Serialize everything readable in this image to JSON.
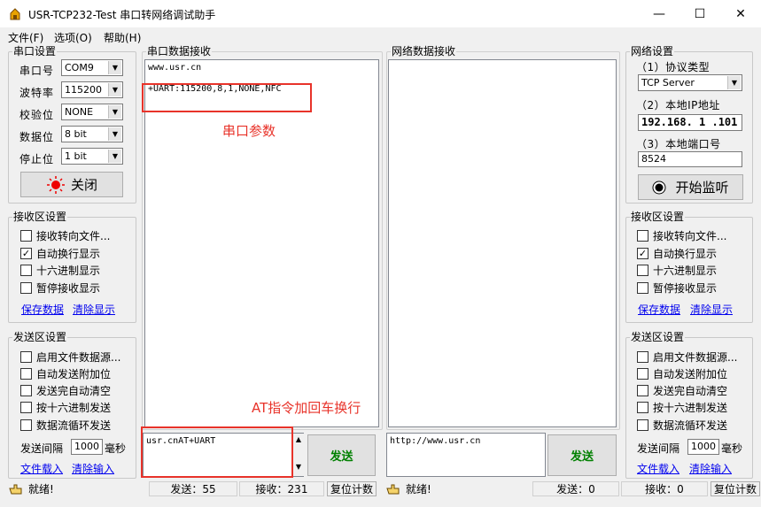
{
  "window": {
    "title": "USR-TCP232-Test 串口转网络调试助手",
    "minimize": "—",
    "maximize": "☐",
    "close": "✕"
  },
  "menu": [
    "文件(F)",
    "选项(O)",
    "帮助(H)"
  ],
  "serial_settings": {
    "title": "串口设置",
    "port_label": "串口号",
    "port_value": "COM9",
    "baud_label": "波特率",
    "baud_value": "115200",
    "parity_label": "校验位",
    "parity_value": "NONE",
    "data_label": "数据位",
    "data_value": "8 bit",
    "stop_label": "停止位",
    "stop_value": "1 bit",
    "close_button": "关闭"
  },
  "left_recv": {
    "title": "接收区设置",
    "options": [
      {
        "label": "接收转向文件...",
        "checked": false
      },
      {
        "label": "自动换行显示",
        "checked": true
      },
      {
        "label": "十六进制显示",
        "checked": false
      },
      {
        "label": "暂停接收显示",
        "checked": false
      }
    ],
    "save_link": "保存数据",
    "clear_link": "清除显示"
  },
  "left_send": {
    "title": "发送区设置",
    "options": [
      {
        "label": "启用文件数据源...",
        "checked": false
      },
      {
        "label": "自动发送附加位",
        "checked": false
      },
      {
        "label": "发送完自动清空",
        "checked": false
      },
      {
        "label": "按十六进制发送",
        "checked": false
      },
      {
        "label": "数据流循环发送",
        "checked": false
      }
    ],
    "interval_label": "发送间隔",
    "interval_value": "1000",
    "interval_unit": "毫秒",
    "load_link": "文件载入",
    "clear_link": "清除输入"
  },
  "serial_recv": {
    "title": "串口数据接收",
    "line1": "www.usr.cn",
    "line2": "+UART:115200,8,1,NONE,NFC"
  },
  "net_recv": {
    "title": "网络数据接收"
  },
  "serial_send": {
    "text": "usr.cnAT+UART",
    "button": "发送"
  },
  "net_send": {
    "text": "http://www.usr.cn",
    "button": "发送"
  },
  "net_settings": {
    "title": "网络设置",
    "protocol_label": "（1）协议类型",
    "protocol_value": "TCP Server",
    "ip_label": "（2）本地IP地址",
    "ip_value": "192.168. 1 .101",
    "port_label": "（3）本地端口号",
    "port_value": "8524",
    "listen_button": "开始监听"
  },
  "right_recv": {
    "title": "接收区设置",
    "options": [
      {
        "label": "接收转向文件...",
        "checked": false
      },
      {
        "label": "自动换行显示",
        "checked": true
      },
      {
        "label": "十六进制显示",
        "checked": false
      },
      {
        "label": "暂停接收显示",
        "checked": false
      }
    ],
    "save_link": "保存数据",
    "clear_link": "清除显示"
  },
  "right_send": {
    "title": "发送区设置",
    "options": [
      {
        "label": "启用文件数据源...",
        "checked": false
      },
      {
        "label": "自动发送附加位",
        "checked": false
      },
      {
        "label": "发送完自动清空",
        "checked": false
      },
      {
        "label": "按十六进制发送",
        "checked": false
      },
      {
        "label": "数据流循环发送",
        "checked": false
      }
    ],
    "interval_label": "发送间隔",
    "interval_value": "1000",
    "interval_unit": "毫秒",
    "load_link": "文件载入",
    "clear_link": "清除输入"
  },
  "status": {
    "left_ready": "就绪!",
    "left_sent": "发送：55",
    "left_recv": "接收：231",
    "left_reset": "复位计数",
    "right_ready": "就绪!",
    "right_sent": "发送：0",
    "right_recv": "接收：0",
    "right_reset": "复位计数"
  },
  "annotations": {
    "serial_params": "串口参数",
    "at_note": "AT指令加回车换行"
  },
  "colors": {
    "annotation": "#e8332a",
    "link": "#0000ee",
    "send_text": "#008000"
  }
}
